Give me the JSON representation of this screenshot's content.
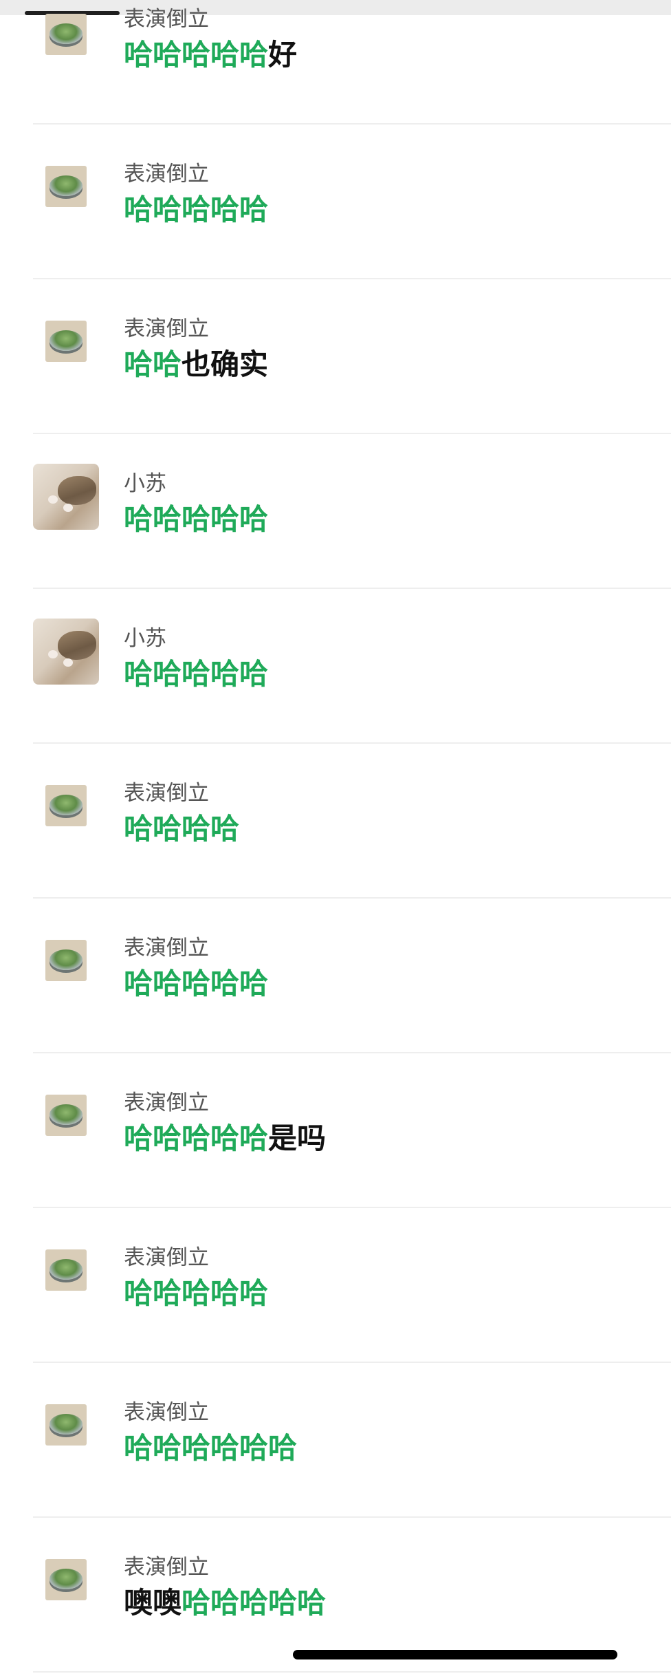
{
  "colors": {
    "highlight": "#1faa59",
    "text": "#111111",
    "sender": "#555555",
    "divider": "#eeeeee"
  },
  "messages": [
    {
      "sender": "表演倒立",
      "avatar": "bowl-avatar",
      "highlight": "哈哈哈哈哈",
      "rest": "好"
    },
    {
      "sender": "表演倒立",
      "avatar": "bowl-avatar",
      "highlight": "哈哈哈哈哈",
      "rest": ""
    },
    {
      "sender": "表演倒立",
      "avatar": "bowl-avatar",
      "highlight": "哈哈",
      "rest": "也确实"
    },
    {
      "sender": "小苏",
      "avatar": "cat-avatar",
      "highlight": "哈哈哈哈哈",
      "rest": ""
    },
    {
      "sender": "小苏",
      "avatar": "cat-avatar",
      "highlight": "哈哈哈哈哈",
      "rest": ""
    },
    {
      "sender": "表演倒立",
      "avatar": "bowl-avatar",
      "highlight": "哈哈哈哈",
      "rest": ""
    },
    {
      "sender": "表演倒立",
      "avatar": "bowl-avatar",
      "highlight": "哈哈哈哈哈",
      "rest": ""
    },
    {
      "sender": "表演倒立",
      "avatar": "bowl-avatar",
      "highlight": "哈哈哈哈哈",
      "rest": "是吗"
    },
    {
      "sender": "表演倒立",
      "avatar": "bowl-avatar",
      "highlight": "哈哈哈哈哈",
      "rest": ""
    },
    {
      "sender": "表演倒立",
      "avatar": "bowl-avatar",
      "highlight": "哈哈哈哈哈哈",
      "rest": ""
    },
    {
      "sender": "表演倒立",
      "avatar": "bowl-avatar",
      "prefix": "噢噢",
      "highlight": "哈哈哈哈哈",
      "rest": ""
    }
  ]
}
